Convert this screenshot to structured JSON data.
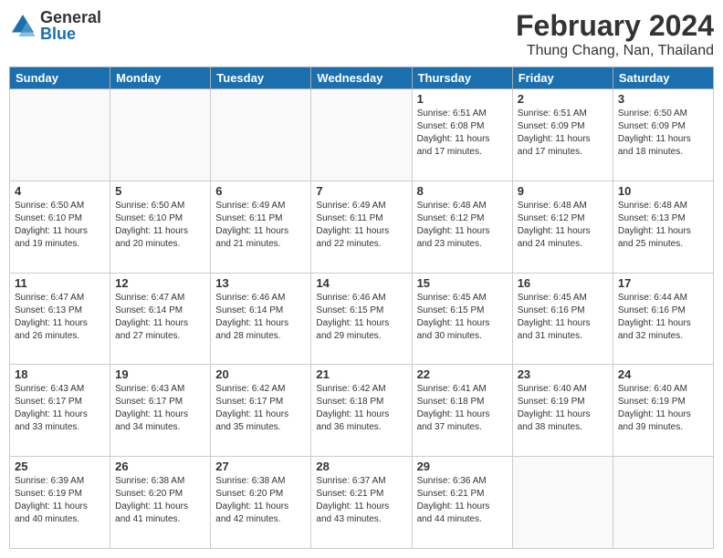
{
  "header": {
    "logo": {
      "general": "General",
      "blue": "Blue"
    },
    "title": "February 2024",
    "subtitle": "Thung Chang, Nan, Thailand"
  },
  "days_of_week": [
    "Sunday",
    "Monday",
    "Tuesday",
    "Wednesday",
    "Thursday",
    "Friday",
    "Saturday"
  ],
  "weeks": [
    [
      {
        "day": "",
        "info": ""
      },
      {
        "day": "",
        "info": ""
      },
      {
        "day": "",
        "info": ""
      },
      {
        "day": "",
        "info": ""
      },
      {
        "day": "1",
        "info": "Sunrise: 6:51 AM\nSunset: 6:08 PM\nDaylight: 11 hours and 17 minutes."
      },
      {
        "day": "2",
        "info": "Sunrise: 6:51 AM\nSunset: 6:09 PM\nDaylight: 11 hours and 17 minutes."
      },
      {
        "day": "3",
        "info": "Sunrise: 6:50 AM\nSunset: 6:09 PM\nDaylight: 11 hours and 18 minutes."
      }
    ],
    [
      {
        "day": "4",
        "info": "Sunrise: 6:50 AM\nSunset: 6:10 PM\nDaylight: 11 hours and 19 minutes."
      },
      {
        "day": "5",
        "info": "Sunrise: 6:50 AM\nSunset: 6:10 PM\nDaylight: 11 hours and 20 minutes."
      },
      {
        "day": "6",
        "info": "Sunrise: 6:49 AM\nSunset: 6:11 PM\nDaylight: 11 hours and 21 minutes."
      },
      {
        "day": "7",
        "info": "Sunrise: 6:49 AM\nSunset: 6:11 PM\nDaylight: 11 hours and 22 minutes."
      },
      {
        "day": "8",
        "info": "Sunrise: 6:48 AM\nSunset: 6:12 PM\nDaylight: 11 hours and 23 minutes."
      },
      {
        "day": "9",
        "info": "Sunrise: 6:48 AM\nSunset: 6:12 PM\nDaylight: 11 hours and 24 minutes."
      },
      {
        "day": "10",
        "info": "Sunrise: 6:48 AM\nSunset: 6:13 PM\nDaylight: 11 hours and 25 minutes."
      }
    ],
    [
      {
        "day": "11",
        "info": "Sunrise: 6:47 AM\nSunset: 6:13 PM\nDaylight: 11 hours and 26 minutes."
      },
      {
        "day": "12",
        "info": "Sunrise: 6:47 AM\nSunset: 6:14 PM\nDaylight: 11 hours and 27 minutes."
      },
      {
        "day": "13",
        "info": "Sunrise: 6:46 AM\nSunset: 6:14 PM\nDaylight: 11 hours and 28 minutes."
      },
      {
        "day": "14",
        "info": "Sunrise: 6:46 AM\nSunset: 6:15 PM\nDaylight: 11 hours and 29 minutes."
      },
      {
        "day": "15",
        "info": "Sunrise: 6:45 AM\nSunset: 6:15 PM\nDaylight: 11 hours and 30 minutes."
      },
      {
        "day": "16",
        "info": "Sunrise: 6:45 AM\nSunset: 6:16 PM\nDaylight: 11 hours and 31 minutes."
      },
      {
        "day": "17",
        "info": "Sunrise: 6:44 AM\nSunset: 6:16 PM\nDaylight: 11 hours and 32 minutes."
      }
    ],
    [
      {
        "day": "18",
        "info": "Sunrise: 6:43 AM\nSunset: 6:17 PM\nDaylight: 11 hours and 33 minutes."
      },
      {
        "day": "19",
        "info": "Sunrise: 6:43 AM\nSunset: 6:17 PM\nDaylight: 11 hours and 34 minutes."
      },
      {
        "day": "20",
        "info": "Sunrise: 6:42 AM\nSunset: 6:17 PM\nDaylight: 11 hours and 35 minutes."
      },
      {
        "day": "21",
        "info": "Sunrise: 6:42 AM\nSunset: 6:18 PM\nDaylight: 11 hours and 36 minutes."
      },
      {
        "day": "22",
        "info": "Sunrise: 6:41 AM\nSunset: 6:18 PM\nDaylight: 11 hours and 37 minutes."
      },
      {
        "day": "23",
        "info": "Sunrise: 6:40 AM\nSunset: 6:19 PM\nDaylight: 11 hours and 38 minutes."
      },
      {
        "day": "24",
        "info": "Sunrise: 6:40 AM\nSunset: 6:19 PM\nDaylight: 11 hours and 39 minutes."
      }
    ],
    [
      {
        "day": "25",
        "info": "Sunrise: 6:39 AM\nSunset: 6:19 PM\nDaylight: 11 hours and 40 minutes."
      },
      {
        "day": "26",
        "info": "Sunrise: 6:38 AM\nSunset: 6:20 PM\nDaylight: 11 hours and 41 minutes."
      },
      {
        "day": "27",
        "info": "Sunrise: 6:38 AM\nSunset: 6:20 PM\nDaylight: 11 hours and 42 minutes."
      },
      {
        "day": "28",
        "info": "Sunrise: 6:37 AM\nSunset: 6:21 PM\nDaylight: 11 hours and 43 minutes."
      },
      {
        "day": "29",
        "info": "Sunrise: 6:36 AM\nSunset: 6:21 PM\nDaylight: 11 hours and 44 minutes."
      },
      {
        "day": "",
        "info": ""
      },
      {
        "day": "",
        "info": ""
      }
    ]
  ]
}
